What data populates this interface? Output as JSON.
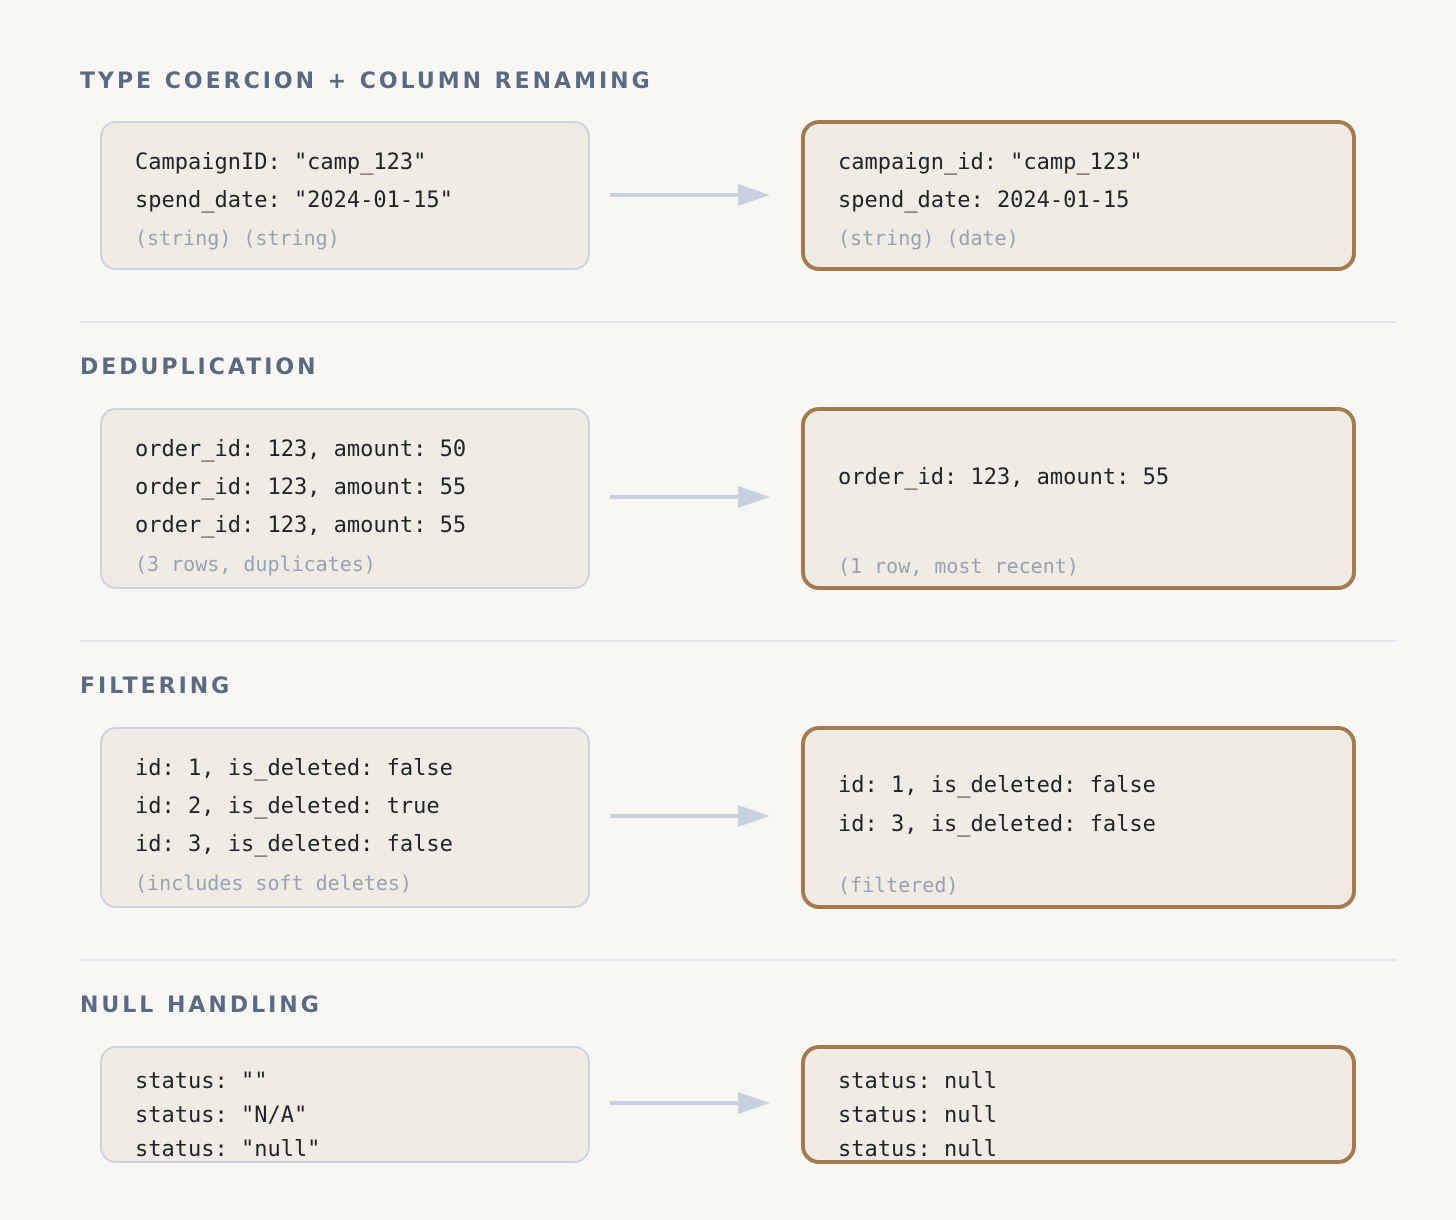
{
  "sections": [
    {
      "title": "TYPE COERCION + COLUMN RENAMING",
      "input": {
        "lines": [
          "CampaignID: \"camp_123\"",
          "spend_date: \"2024-01-15\""
        ],
        "note": "(string) (string)"
      },
      "output": {
        "lines": [
          "campaign_id: \"camp_123\"",
          "spend_date: 2024-01-15"
        ],
        "note": "(string) (date)"
      }
    },
    {
      "title": "DEDUPLICATION",
      "input": {
        "lines": [
          "order_id: 123, amount: 50",
          "order_id: 123, amount: 55",
          "order_id: 123, amount: 55"
        ],
        "note": "(3 rows, duplicates)"
      },
      "output": {
        "lines": [
          "order_id: 123, amount: 55"
        ],
        "note": "(1 row, most recent)"
      }
    },
    {
      "title": "FILTERING",
      "input": {
        "lines": [
          "id: 1, is_deleted: false",
          "id: 2, is_deleted: true",
          "id: 3, is_deleted: false"
        ],
        "note": "(includes soft deletes)"
      },
      "output": {
        "lines": [
          "id: 1, is_deleted: false",
          "id: 3, is_deleted: false"
        ],
        "note": "(filtered)"
      }
    },
    {
      "title": "NULL HANDLING",
      "input": {
        "lines": [
          "status: \"\"",
          "status: \"N/A\"",
          "status: \"null\""
        ]
      },
      "output": {
        "lines": [
          "status: null",
          "status: null",
          "status: null"
        ]
      }
    }
  ],
  "colors": {
    "background": "#f8f7f4",
    "title": "#5a6a82",
    "box_fill": "#f0ece3",
    "input_border": "#cdd4df",
    "output_border": "#a47a4f",
    "arrow": "#c8d1df",
    "note": "#97a2b3",
    "text": "#1f2429"
  }
}
